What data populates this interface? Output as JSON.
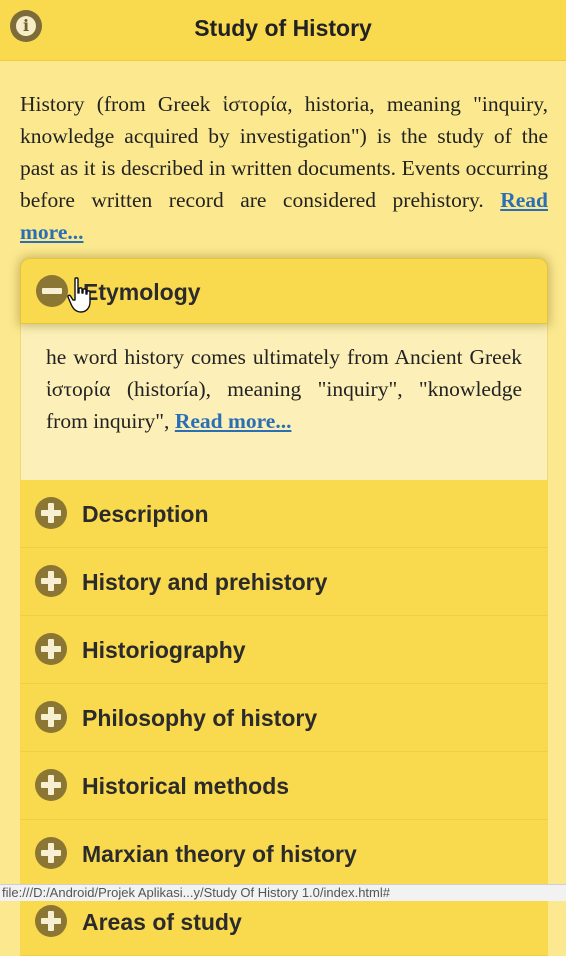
{
  "header": {
    "title": "Study of History",
    "info_icon": "info-icon"
  },
  "intro": {
    "text": "History (from Greek ἱστορία, historia, meaning \"inquiry, knowledge acquired by investigation\") is the study of the past as it is described in written documents. Events occurring before written record are considered prehistory.",
    "read_more": "Read more..."
  },
  "accordion": {
    "open_item": {
      "label": "Etymology",
      "icon": "minus-circle-icon",
      "content": "he word history comes ultimately from Ancient Greek ἱστορία (historía), meaning \"inquiry\", \"knowledge from inquiry\",",
      "read_more": "Read more..."
    },
    "items": [
      {
        "label": "Description",
        "icon": "plus-circle-icon"
      },
      {
        "label": "History and prehistory",
        "icon": "plus-circle-icon"
      },
      {
        "label": "Historiography",
        "icon": "plus-circle-icon"
      },
      {
        "label": "Philosophy of history",
        "icon": "plus-circle-icon"
      },
      {
        "label": "Historical methods",
        "icon": "plus-circle-icon"
      },
      {
        "label": "Marxian theory of history",
        "icon": "plus-circle-icon"
      },
      {
        "label": "Areas of study",
        "icon": "plus-circle-icon"
      }
    ]
  },
  "status_bar": {
    "url": "file:///D:/Android/Projek Aplikasi...y/Study Of History 1.0/index.html#"
  },
  "colors": {
    "header_bg": "#f9d94e",
    "page_bg": "#fce98f",
    "icon_bg": "#8b7633",
    "link": "#2a6fb6"
  }
}
